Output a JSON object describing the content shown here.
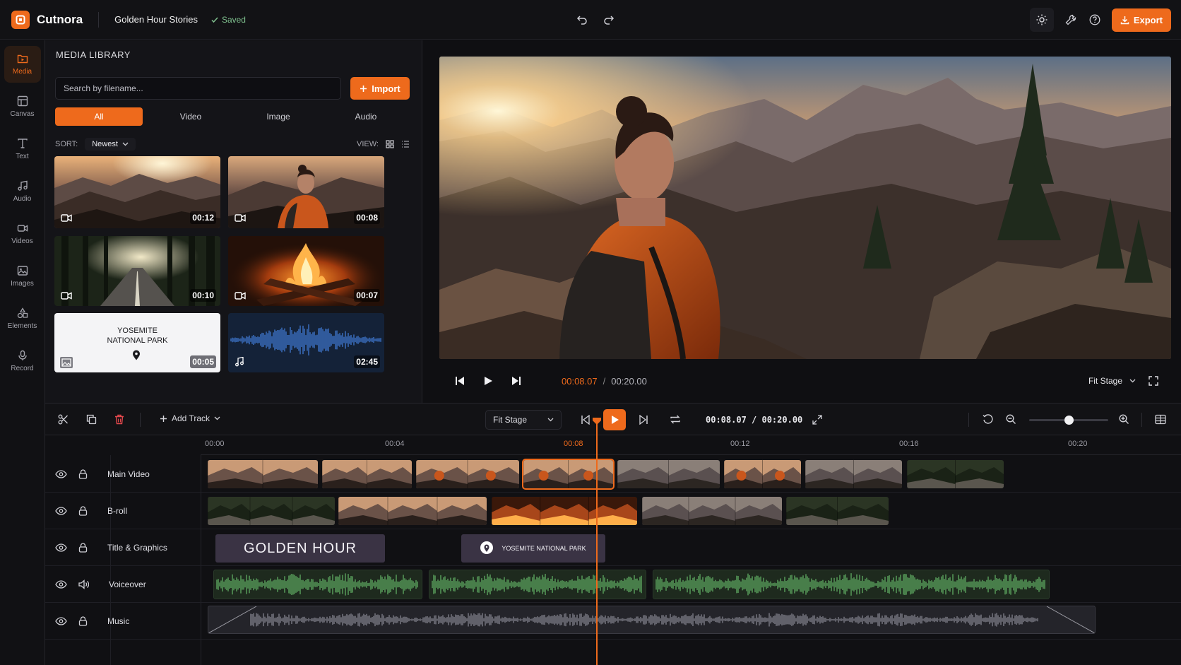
{
  "app": {
    "name": "Cutnora",
    "project": "Golden Hour Stories",
    "status": "Saved",
    "export_label": "Export"
  },
  "nav": {
    "items": [
      {
        "label": "Media",
        "icon": "media-icon",
        "active": true
      },
      {
        "label": "Canvas",
        "icon": "canvas-icon"
      },
      {
        "label": "Text",
        "icon": "text-icon"
      },
      {
        "label": "Audio",
        "icon": "music-note-icon"
      },
      {
        "label": "Videos",
        "icon": "video-camera-icon"
      },
      {
        "label": "Images",
        "icon": "image-icon"
      },
      {
        "label": "Elements",
        "icon": "shapes-icon"
      },
      {
        "label": "Record",
        "icon": "microphone-icon"
      }
    ]
  },
  "media": {
    "title": "MEDIA LIBRARY",
    "search_placeholder": "Search by filename...",
    "import_label": "Import",
    "filters": [
      "All",
      "Video",
      "Image",
      "Audio"
    ],
    "sort_label": "SORT:",
    "sort_value": "Newest",
    "view_label": "VIEW:",
    "items": [
      {
        "type": "video",
        "duration": "00:12",
        "scene": "mountain sunset"
      },
      {
        "type": "video",
        "duration": "00:08",
        "scene": "hiker"
      },
      {
        "type": "video",
        "duration": "00:10",
        "scene": "forest road"
      },
      {
        "type": "video",
        "duration": "00:07",
        "scene": "campfire"
      },
      {
        "type": "image",
        "duration": "00:05",
        "title_line1": "YOSEMITE",
        "title_line2": "NATIONAL PARK"
      },
      {
        "type": "audio",
        "duration": "02:45"
      }
    ]
  },
  "preview": {
    "current": "00:08.07",
    "separator": "/",
    "total": "00:20.00",
    "fit": "Fit Stage"
  },
  "timeline": {
    "add_track": "Add Track",
    "fit": "Fit Stage",
    "timecode": "00:08.07 / 00:20.00",
    "zoom_level": 0.5,
    "ruler": [
      "00:00",
      "00:04",
      "00:08",
      "00:12",
      "00:16",
      "00:20"
    ],
    "active_tick": "00:08",
    "tracks": [
      {
        "name": "Main Video",
        "kind": "video"
      },
      {
        "name": "B-roll",
        "kind": "video"
      },
      {
        "name": "Title & Graphics",
        "kind": "graphics"
      },
      {
        "name": "Voiceover",
        "kind": "audio"
      },
      {
        "name": "Music",
        "kind": "audio"
      }
    ],
    "titles": {
      "golden": "GOLDEN HOUR",
      "park": "YOSEMITE NATIONAL PARK"
    }
  },
  "colors": {
    "accent": "#ee6a1c",
    "saved": "#7fc08e",
    "voice": "#5aa25e",
    "music": "#8a8a94"
  }
}
